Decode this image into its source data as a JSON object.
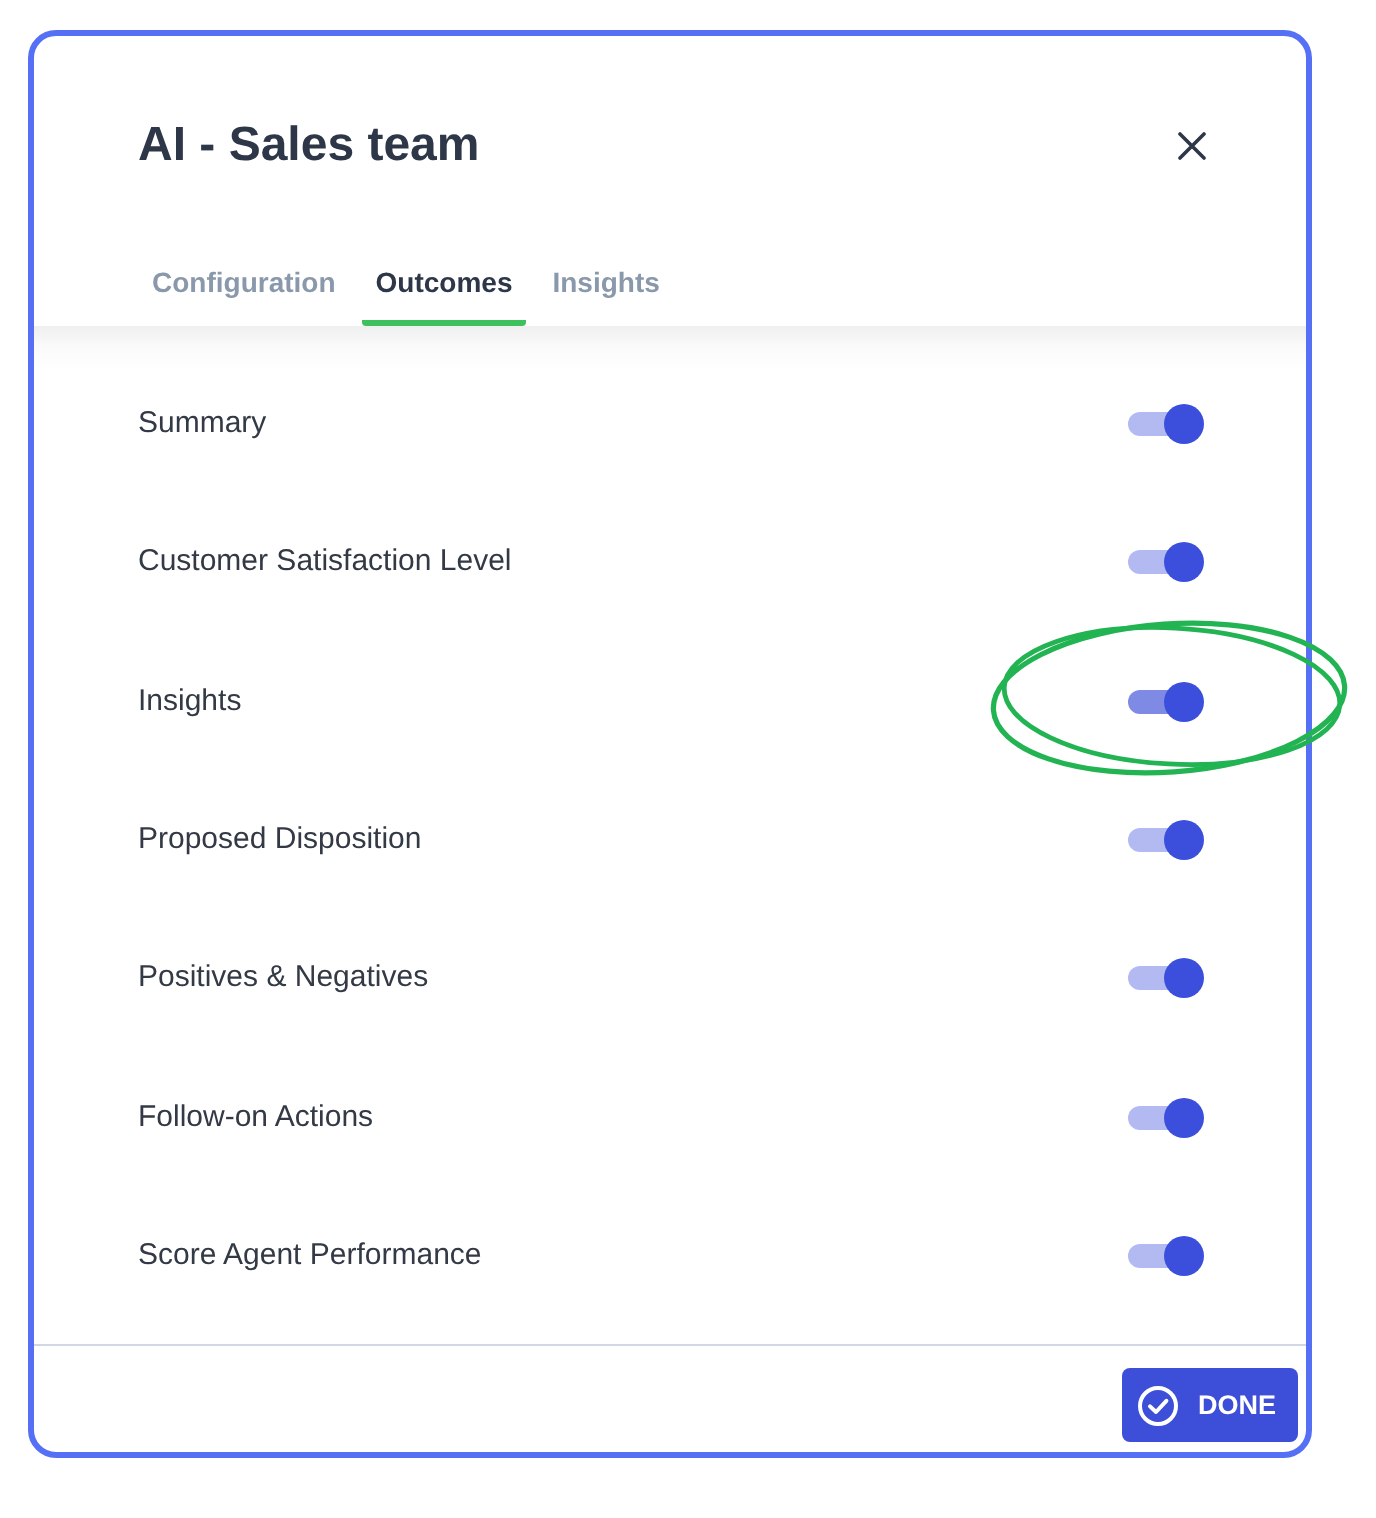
{
  "dialog": {
    "title": "AI - Sales team"
  },
  "tabs": [
    {
      "label": "Configuration",
      "selected": false
    },
    {
      "label": "Outcomes",
      "selected": true
    },
    {
      "label": "Insights",
      "selected": false
    }
  ],
  "outcomes": [
    {
      "label": "Summary",
      "on": true,
      "focused": false,
      "highlighted": false
    },
    {
      "label": "Customer Satisfaction Level",
      "on": true,
      "focused": false,
      "highlighted": false
    },
    {
      "label": "Insights",
      "on": true,
      "focused": true,
      "highlighted": true
    },
    {
      "label": "Proposed Disposition",
      "on": true,
      "focused": false,
      "highlighted": false
    },
    {
      "label": "Positives & Negatives",
      "on": true,
      "focused": false,
      "highlighted": false
    },
    {
      "label": "Follow-on Actions",
      "on": true,
      "focused": false,
      "highlighted": false
    },
    {
      "label": "Score Agent Performance",
      "on": true,
      "focused": false,
      "highlighted": false
    }
  ],
  "footer": {
    "done_button": "DONE"
  }
}
